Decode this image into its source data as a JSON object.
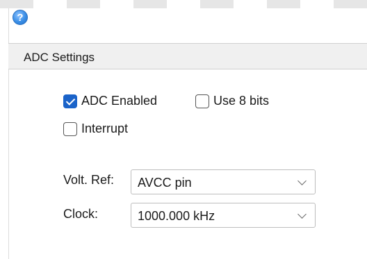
{
  "header": {
    "title": "ADC Settings"
  },
  "options": {
    "adc_enabled": {
      "label": "ADC Enabled",
      "checked": true
    },
    "use_8_bits": {
      "label": "Use 8 bits",
      "checked": false
    },
    "interrupt": {
      "label": "Interrupt",
      "checked": false
    }
  },
  "fields": {
    "volt_ref": {
      "label": "Volt. Ref:",
      "value": "AVCC pin"
    },
    "clock": {
      "label": "Clock:",
      "value": "1000.000 kHz"
    }
  },
  "icons": {
    "help": "help-icon",
    "dropdown": "chevron-down-icon"
  },
  "colors": {
    "accent": "#1a63c9",
    "header_bg": "#f0f0f0"
  }
}
